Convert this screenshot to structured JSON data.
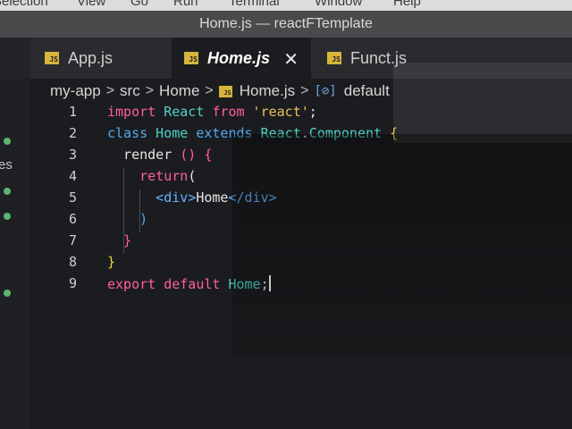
{
  "menubar": {
    "items": [
      "Selection",
      "View",
      "Go",
      "Run",
      "Terminal",
      "Window",
      "Help"
    ]
  },
  "window": {
    "title": "Home.js — reactFTemplate"
  },
  "tabs": [
    {
      "label": "App.js",
      "icon": "js-file-icon",
      "icon_text": "JS",
      "active": false
    },
    {
      "label": "Home.js",
      "icon": "js-file-icon",
      "icon_text": "JS",
      "active": true,
      "close": "✕"
    },
    {
      "label": "Funct.js",
      "icon": "js-file-icon",
      "icon_text": "JS",
      "active": false
    }
  ],
  "breadcrumb": {
    "parts": [
      "my-app",
      "src",
      "Home",
      "Home.js",
      "default"
    ],
    "separator": ">",
    "file_icon_text": "JS",
    "symbol_icon": "[⊘]"
  },
  "sidebar": {
    "partial_text": "es"
  },
  "editor": {
    "line_numbers": [
      "1",
      "2",
      "3",
      "4",
      "5",
      "6",
      "7",
      "8",
      "9"
    ],
    "lines": [
      [
        {
          "t": "import",
          "c": "kw-pink"
        },
        {
          "t": " React ",
          "c": "cls"
        },
        {
          "t": "from",
          "c": "kw-pink"
        },
        {
          "t": " 'react'",
          "c": "str"
        },
        {
          "t": ";",
          "c": "plain"
        }
      ],
      [
        {
          "t": "class",
          "c": "kw-blue"
        },
        {
          "t": " Home ",
          "c": "cls"
        },
        {
          "t": "extends",
          "c": "kw-blue"
        },
        {
          "t": " React",
          "c": "cls"
        },
        {
          "t": ".",
          "c": "plain"
        },
        {
          "t": "Component",
          "c": "cls"
        },
        {
          "t": " {",
          "c": "br-yellow"
        }
      ],
      [
        {
          "t": "  render",
          "c": "plain"
        },
        {
          "t": " ()",
          "c": "br-pink"
        },
        {
          "t": " {",
          "c": "br-pink"
        }
      ],
      [
        {
          "t": "    return",
          "c": "kw-pink"
        },
        {
          "t": "(",
          "c": "plain"
        }
      ],
      [
        {
          "t": "      <",
          "c": "tag"
        },
        {
          "t": "div",
          "c": "tag"
        },
        {
          "t": ">",
          "c": "tag"
        },
        {
          "t": "Home",
          "c": "plain"
        },
        {
          "t": "</",
          "c": "tag"
        },
        {
          "t": "div",
          "c": "tag"
        },
        {
          "t": ">",
          "c": "tag"
        }
      ],
      [
        {
          "t": "    )",
          "c": "br-blue"
        }
      ],
      [
        {
          "t": "  }",
          "c": "br-pink"
        }
      ],
      [
        {
          "t": "}",
          "c": "br-yellow"
        }
      ],
      [
        {
          "t": "export",
          "c": "kw-pink"
        },
        {
          "t": " default ",
          "c": "kw-pink"
        },
        {
          "t": "Home",
          "c": "cls"
        },
        {
          "t": ";",
          "c": "plain"
        }
      ]
    ],
    "cursor_line": 9
  },
  "colors": {
    "accent_git_dot": "#5cb574",
    "js_icon": "#d7b53c"
  }
}
